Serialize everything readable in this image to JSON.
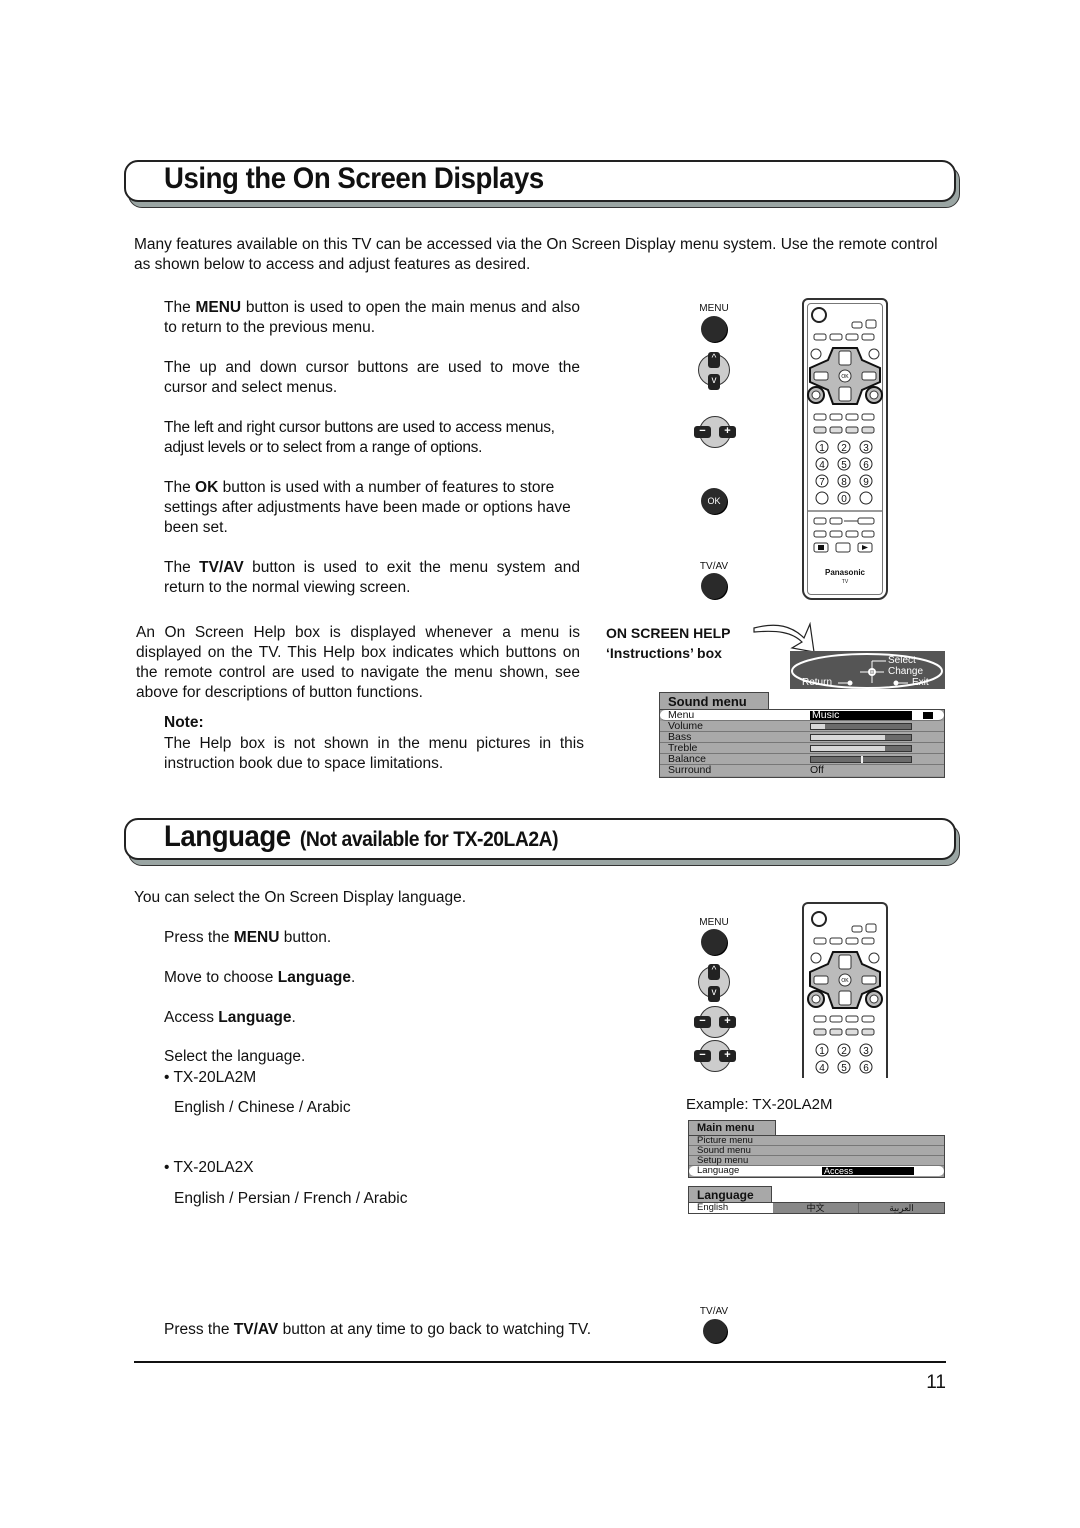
{
  "section1": {
    "title": "Using the On Screen Displays",
    "intro": "Many features available on this TV can be accessed via the On Screen Display menu system. Use the remote control as shown below to access and adjust features as desired.",
    "items": [
      {
        "pre": "The ",
        "bold": "MENU",
        "post": " button is used to open the main menus and also to return to the previous menu."
      },
      {
        "pre": "The up and down cursor buttons are used to move the cursor and select menus.",
        "bold": "",
        "post": ""
      },
      {
        "pre": "The left and right cursor buttons are used to access menus, adjust levels or to select from a range of options.",
        "bold": "",
        "post": ""
      },
      {
        "pre": "The ",
        "bold": "OK",
        "post": " button is used with a number of features to store settings after adjustments have been made or options have been set."
      },
      {
        "pre": "The ",
        "bold": "TV/AV",
        "post": " button is used to exit the menu system and return to the normal viewing screen."
      }
    ],
    "buttons": {
      "menu": "MENU",
      "ok": "OK",
      "tvav": "TV/AV",
      "up": "^",
      "down": "v",
      "minus": "−",
      "plus": "+"
    },
    "help_paragraph": "An On Screen Help box is displayed whenever a menu is displayed on the TV. This Help box indicates which buttons on the remote control are used to navigate the menu shown, see above for descriptions of button functions.",
    "note_label": "Note:",
    "note_text": "The Help box is not shown in the menu pictures in this instruction book due to space limitations.",
    "help_callout_line1": "ON SCREEN HELP",
    "help_callout_line2": "‘Instructions’ box",
    "help_box": {
      "select": "Select",
      "change": "Change",
      "return": "Return",
      "exit": "Exit"
    },
    "sound_menu": {
      "title": "Sound menu",
      "rows": [
        {
          "label": "Menu",
          "value": "Music",
          "type": "text",
          "selected": true
        },
        {
          "label": "Volume",
          "type": "bar",
          "level": 0.14
        },
        {
          "label": "Bass",
          "type": "bar",
          "level": 0.74
        },
        {
          "label": "Treble",
          "type": "bar",
          "level": 0.74
        },
        {
          "label": "Balance",
          "type": "balance",
          "level": 0.5
        },
        {
          "label": "Surround",
          "value": "Off",
          "type": "text"
        }
      ]
    }
  },
  "remote": {
    "brand": "Panasonic",
    "sub": "TV",
    "ok": "OK",
    "numbers": [
      "1",
      "2",
      "3",
      "4",
      "5",
      "6",
      "7",
      "8",
      "9",
      "",
      "0",
      ""
    ]
  },
  "section2": {
    "title": "Language",
    "subtitle": "(Not available for TX-20LA2A)",
    "intro": "You can select the On Screen Display language.",
    "step1_pre": "Press the ",
    "step1_bold": "MENU",
    "step1_post": " button.",
    "step2_pre": "Move to choose ",
    "step2_bold": "Language",
    "step2_post": ".",
    "step3_pre": "Access ",
    "step3_bold": "Language",
    "step3_post": ".",
    "step4": "Select the language.",
    "model1": "• TX-20LA2M",
    "model1_langs": "English / Chinese / Arabic",
    "model2": "• TX-20LA2X",
    "model2_langs": "English / Persian / French / Arabic",
    "example_label": "Example: TX-20LA2M",
    "main_menu": {
      "title": "Main menu",
      "rows": [
        {
          "label": "Picture menu"
        },
        {
          "label": "Sound menu"
        },
        {
          "label": "Setup menu"
        },
        {
          "label": "Language",
          "value": "Access",
          "selected": true
        }
      ]
    },
    "language_menu": {
      "title": "Language",
      "options": [
        "English",
        "中文",
        "العربية"
      ],
      "selected": "English"
    },
    "footer_pre": "Press the ",
    "footer_bold": "TV/AV",
    "footer_post": " button at any time to go back to watching TV.",
    "tvav_label": "TV/AV"
  },
  "page_number": "11"
}
